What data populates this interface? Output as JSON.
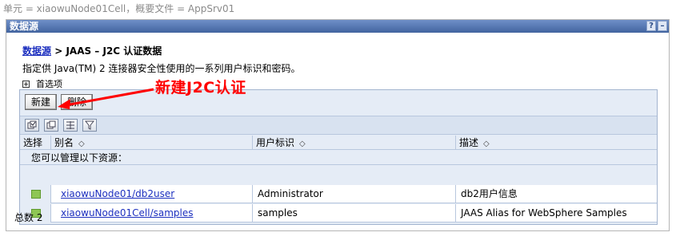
{
  "scope": "单元 = xiaowuNode01Cell，概要文件 = AppSrv01",
  "panel": {
    "title": "数据源",
    "help_label": "?",
    "minimize_label": "–"
  },
  "breadcrumb": {
    "link": "数据源",
    "separator": " > ",
    "current": "JAAS – J2C 认证数据"
  },
  "description": "指定供 Java(TM) 2 连接器安全性使用的一系列用户标识和密码。",
  "preferences_label": "首选项",
  "annotation": "新建J2C认证",
  "buttons": {
    "new": "新建",
    "delete": "删除"
  },
  "icons": [
    "select-all-icon",
    "deselect-all-icon",
    "show-filter-icon",
    "clear-filter-icon"
  ],
  "table": {
    "columns": [
      "选择",
      "别名",
      "用户标识",
      "描述"
    ],
    "scope_note": "您可以管理以下资源：",
    "rows": [
      {
        "alias": "xiaowuNode01/db2user",
        "user": "Administrator",
        "description": "db2用户信息"
      },
      {
        "alias": "xiaowuNode01Cell/samples",
        "user": "samples",
        "description": "JAAS Alias for WebSphere Samples"
      }
    ],
    "total_label": "总数 2"
  },
  "colors": {
    "title_bar": "#42649f",
    "link": "#1c2fbf",
    "annotation": "#ff0000",
    "table_bg": "#e5ecf6"
  }
}
